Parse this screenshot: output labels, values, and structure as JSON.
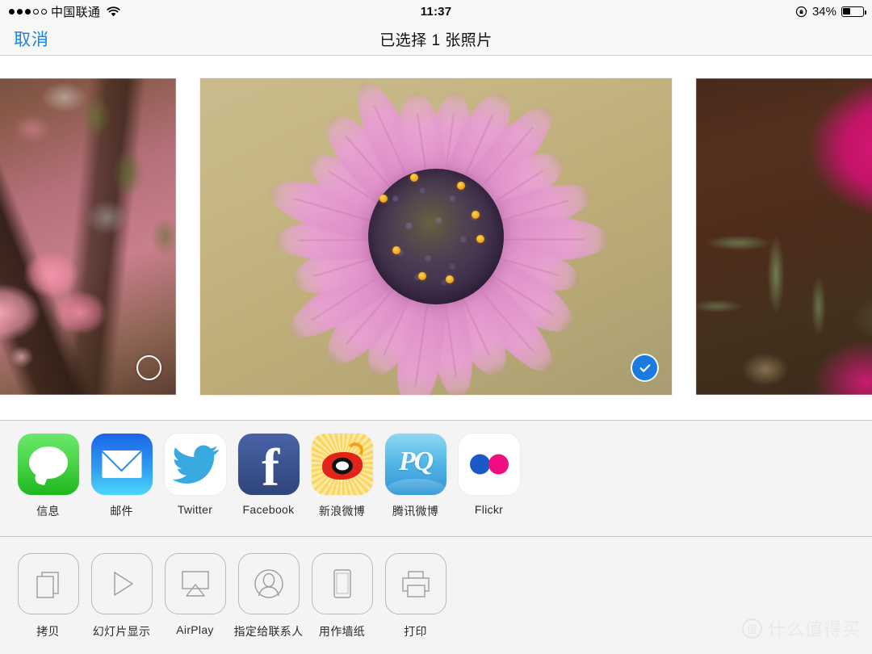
{
  "status_bar": {
    "signal_dots_filled": 3,
    "signal_dots_total": 5,
    "carrier": "中国联通",
    "wifi_icon": "wifi-icon",
    "time": "11:37",
    "rotation_lock_icon": "rotation-lock-icon",
    "battery_percent": "34%",
    "battery_level": 34
  },
  "nav_bar": {
    "cancel_label": "取消",
    "title": "已选择 1 张照片"
  },
  "photos": [
    {
      "name": "cherry-blossom-photo",
      "selected": false,
      "alt": "粉色樱花"
    },
    {
      "name": "purple-daisy-photo",
      "selected": true,
      "alt": "紫色雏菊"
    },
    {
      "name": "magenta-petal-photo",
      "selected": false,
      "alt": "洋红花瓣"
    }
  ],
  "share_apps": [
    {
      "label": "信息",
      "icon": "messages-icon",
      "color": "#4ad44a"
    },
    {
      "label": "邮件",
      "icon": "mail-icon",
      "color": "#2f9bf0"
    },
    {
      "label": "Twitter",
      "icon": "twitter-icon",
      "color": "#3aa9e0"
    },
    {
      "label": "Facebook",
      "icon": "facebook-icon",
      "color": "#3b5490"
    },
    {
      "label": "新浪微博",
      "icon": "sina-weibo-icon",
      "color": "#e2231a"
    },
    {
      "label": "腾讯微博",
      "icon": "tencent-weibo-icon",
      "color": "#55b7e6"
    },
    {
      "label": "Flickr",
      "icon": "flickr-icon",
      "color": "#ef0e7f"
    }
  ],
  "actions": [
    {
      "label": "拷贝",
      "icon": "copy-icon"
    },
    {
      "label": "幻灯片显示",
      "icon": "slideshow-icon"
    },
    {
      "label": "AirPlay",
      "icon": "airplay-icon"
    },
    {
      "label": "指定给联系人",
      "icon": "assign-contact-icon"
    },
    {
      "label": "用作墙纸",
      "icon": "wallpaper-icon"
    },
    {
      "label": "打印",
      "icon": "print-icon"
    }
  ],
  "watermark": {
    "badge": "值",
    "text": "什么值得买"
  },
  "colors": {
    "accent_blue": "#1782e5",
    "selection_blue": "#1a7ae0",
    "panel_bg": "#f4f4f4",
    "navbar_bg": "#f7f7f7"
  }
}
